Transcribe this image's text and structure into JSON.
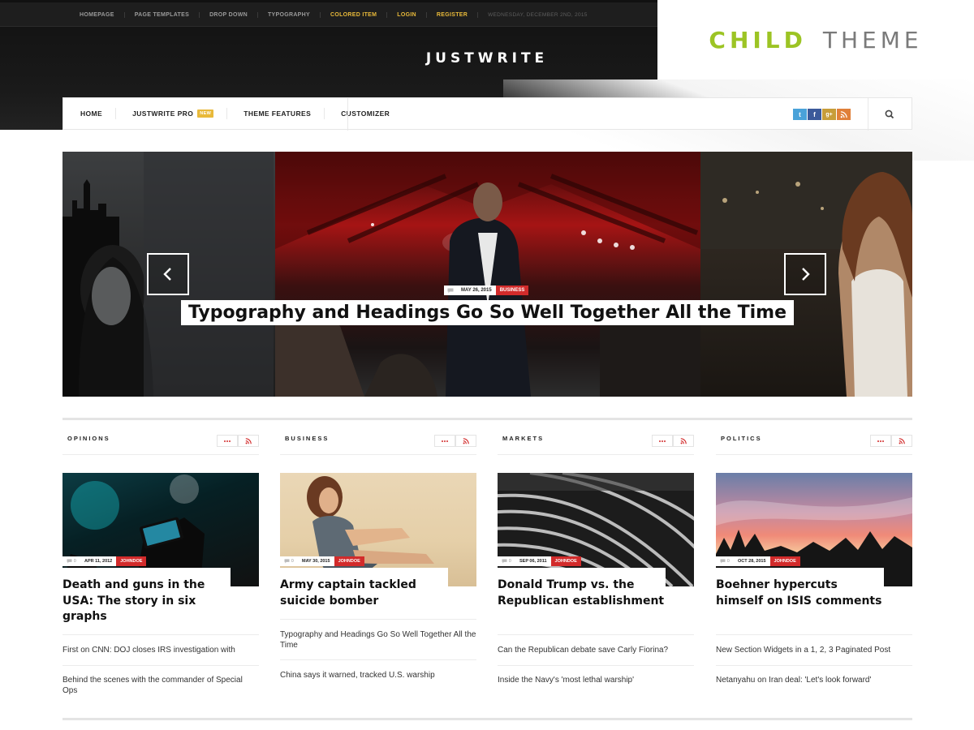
{
  "topbar": {
    "links": [
      {
        "label": "HOMEPAGE",
        "accent": false
      },
      {
        "label": "PAGE TEMPLATES",
        "accent": false
      },
      {
        "label": "DROP DOWN",
        "accent": false
      },
      {
        "label": "TYPOGRAPHY",
        "accent": false
      },
      {
        "label": "COLORED ITEM",
        "accent": true
      },
      {
        "label": "LOGIN",
        "accent": true
      },
      {
        "label": "REGISTER",
        "accent": true
      }
    ],
    "date": "WEDNESDAY, DECEMBER 2ND, 2015"
  },
  "brand": {
    "name": "JUSTWRITE"
  },
  "badge": {
    "word1": "CHILD",
    "word2": "THEME",
    "accent": "#9cc424"
  },
  "nav": {
    "items": [
      {
        "label": "HOME"
      },
      {
        "label": "JUSTWRITE PRO",
        "badge": "NEW"
      },
      {
        "label": "THEME FEATURES"
      },
      {
        "label": "CUSTOMIZER"
      }
    ],
    "socials": [
      {
        "icon": "twitter-icon",
        "glyph": "t",
        "color": "#4aa2d9"
      },
      {
        "icon": "facebook-icon",
        "glyph": "f",
        "color": "#3b5a9a"
      },
      {
        "icon": "google-plus-icon",
        "glyph": "g+",
        "color": "#c79d3a"
      },
      {
        "icon": "rss-icon",
        "glyph": "))",
        "color": "#e0803a"
      }
    ],
    "search_icon": "search-icon"
  },
  "slider": {
    "date": "MAY 26, 2015",
    "category": "BUSINESS",
    "title": "Typography and Headings Go So Well Together All the Time",
    "prev_icon": "chevron-left-icon",
    "next_icon": "chevron-right-icon"
  },
  "columns": [
    {
      "title": "OPINIONS",
      "comments": "0",
      "date": "APR 11, 2012",
      "author": "JOHNDOE",
      "headline": "Death and guns in the USA: The story in six graphs",
      "related": [
        "First on CNN: DOJ closes IRS investigation with",
        "Behind the scenes with the commander of Special Ops"
      ]
    },
    {
      "title": "BUSINESS",
      "comments": "0",
      "date": "MAY 30, 2015",
      "author": "JOHNDOE",
      "headline": "Army captain tackled suicide bomber",
      "related": [
        "Typography and Headings Go So Well Together All the Time",
        "China says it warned, tracked U.S. warship"
      ]
    },
    {
      "title": "MARKETS",
      "comments": "0",
      "date": "SEP 06, 2011",
      "author": "JOHNDOE",
      "headline": "Donald Trump vs. the Republican establishment",
      "related": [
        "Can the Republican debate save Carly Fiorina?",
        "Inside the Navy's 'most lethal warship'"
      ]
    },
    {
      "title": "POLITICS",
      "comments": "0",
      "date": "OCT 28, 2015",
      "author": "JOHNDOE",
      "headline": "Boehner hypercuts himself on ISIS comments",
      "related": [
        "New Section Widgets in a 1, 2, 3 Paginated Post",
        "Netanyahu on Iran deal: 'Let's look forward'"
      ]
    }
  ],
  "colors": {
    "category_red": "#d22b2b",
    "accent_gold": "#e8b93a"
  }
}
